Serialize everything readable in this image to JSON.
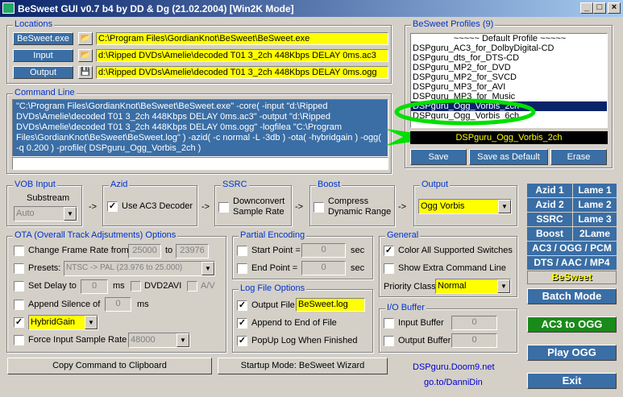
{
  "window": {
    "title": "BeSweet GUI v0.7 b4 by DD & Dg (21.02.2004)  [Win2K Mode]"
  },
  "locations": {
    "label": "Locations",
    "besweet_btn": "BeSweet.exe",
    "besweet_path": "C:\\Program Files\\GordianKnot\\BeSweet\\BeSweet.exe",
    "input_btn": "Input",
    "input_path": "d:\\Ripped DVDs\\Amelie\\decoded T01 3_2ch 448Kbps DELAY 0ms.ac3",
    "output_btn": "Output",
    "output_path": "d:\\Ripped DVDs\\Amelie\\decoded T01 3_2ch 448Kbps DELAY 0ms.ogg"
  },
  "command_line": {
    "label": "Command Line",
    "text": "\"C:\\Program Files\\GordianKnot\\BeSweet\\BeSweet.exe\" -core( -input \"d:\\Ripped DVDs\\Amelie\\decoded T01 3_2ch 448Kbps DELAY 0ms.ac3\" -output \"d:\\Ripped DVDs\\Amelie\\decoded T01 3_2ch 448Kbps DELAY 0ms.ogg\" -logfilea \"C:\\Program Files\\GordianKnot\\BeSweet\\BeSweet.log\" ) -azid( -c normal -L -3db ) -ota( -hybridgain ) -ogg( -q 0.200 ) -profile( DSPguru_Ogg_Vorbis_2ch )"
  },
  "profiles": {
    "label": "BeSweet Profiles (9)",
    "items": [
      "~~~~~ Default Profile ~~~~~",
      "DSPguru_AC3_for_DolbyDigital-CD",
      "DSPguru_dts_for_DTS-CD",
      "DSPguru_MP2_for_DVD",
      "DSPguru_MP2_for_SVCD",
      "DSPguru_MP3_for_AVI",
      "DSPguru_MP3_for_Music",
      "DSPguru_Ogg_Vorbis_2ch",
      "DSPguru_Ogg_Vorbis_6ch"
    ],
    "selected_index": 7,
    "current": "DSPguru_Ogg_Vorbis_2ch",
    "save": "Save",
    "save_default": "Save as Default",
    "erase": "Erase"
  },
  "vob": {
    "label": "VOB Input",
    "substream_label": "Substream",
    "substream_value": "Auto"
  },
  "azid": {
    "label": "Azid",
    "use_ac3": "Use AC3 Decoder",
    "checked": true
  },
  "ssrc": {
    "label": "SSRC",
    "downconvert_line1": "Downconvert",
    "downconvert_line2": "Sample Rate"
  },
  "boost": {
    "label": "Boost",
    "compress_line1": "Compress",
    "compress_line2": "Dynamic Range"
  },
  "output": {
    "label": "Output",
    "value": "Ogg Vorbis"
  },
  "arrows": {
    "a1": "->",
    "a2": "->",
    "a3": "->",
    "a4": "->"
  },
  "ota": {
    "label": "OTA (Overall Track Adjsutments) Options",
    "change_frame": "Change Frame Rate from",
    "fr_from": "25000",
    "to": "to",
    "fr_to": "23976",
    "presets": "Presets:",
    "presets_value": "NTSC -> PAL    (23.976 to 25.000)",
    "set_delay": "Set Delay to",
    "delay_value": "0",
    "ms": "ms",
    "dvd2avi": "DVD2AVI",
    "av": "A/V",
    "append_silence": "Append Silence of",
    "silence_value": "0",
    "ms2": "ms",
    "gain_value": "HybridGain",
    "force_rate": "Force Input Sample Rate",
    "force_rate_value": "48000"
  },
  "partial": {
    "label": "Partial Encoding",
    "start": "Start Point =",
    "start_value": "0",
    "end": "End Point =",
    "end_value": "0",
    "sec1": "sec",
    "sec2": "sec"
  },
  "logfile": {
    "label": "Log File Options",
    "output_file": "Output File",
    "file_value": "BeSweet.log",
    "append": "Append to End of File",
    "popup": "PopUp Log When Finished"
  },
  "general": {
    "label": "General",
    "color_all": "Color All Supported Switches",
    "extra_cmd": "Show Extra Command Line",
    "priority": "Priority Class",
    "priority_value": "Normal"
  },
  "iobuffer": {
    "label": "I/O Buffer",
    "input_buffer": "Input Buffer",
    "input_value": "0",
    "output_buffer": "Output Buffer",
    "output_value": "0"
  },
  "tags": [
    "Azid 1",
    "Lame 1",
    "Azid 2",
    "Lame 2",
    "SSRC",
    "Lame 3",
    "Boost",
    "2Lame",
    "AC3 / OGG / PCM",
    "DTS / AAC / MP4",
    "BeSweet"
  ],
  "buttons": {
    "copy": "Copy Command to Clipboard",
    "startup": "Startup Mode: BeSweet Wizard",
    "batch": "Batch Mode",
    "ac3ogg": "AC3 to OGG",
    "playogg": "Play OGG",
    "exit": "Exit"
  },
  "links": {
    "doom9": "DSPguru.Doom9.net",
    "danni": "go.to/DanniDin"
  },
  "colors": {
    "blue_button": "#3a6ea5",
    "green_button": "#1a8a1a",
    "highlight_green": "#00e000",
    "yellow_field": "#ffff00"
  }
}
